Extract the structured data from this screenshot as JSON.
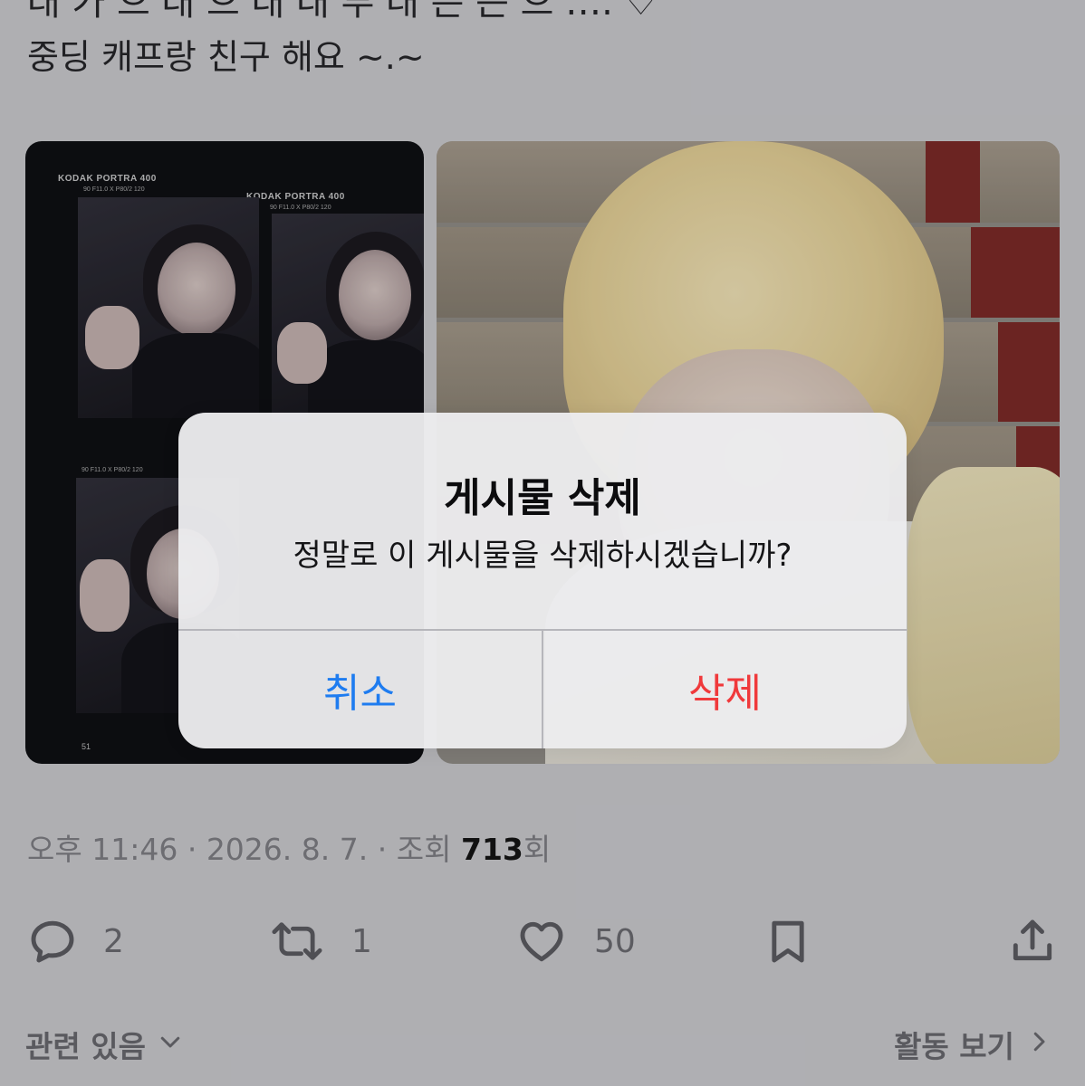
{
  "tweet": {
    "text_cut_line": "대 가 으 대 으 대 대 부 대 은 는 으 …. ♡",
    "text_line": "중딩 캐프랑 친구 해요 ~.~"
  },
  "film": {
    "label_1": "KODAK PORTRA 400",
    "label_2": "KODAK PORTRA 400",
    "sub_1": "90 F11.0     X     P80/2 120",
    "sub_2": "90 F11.0     X     P80/2 120",
    "sub_3": "90 F11.0     X     P80/2 120",
    "frame_number": "51"
  },
  "dialog": {
    "title": "게시물 삭제",
    "message": "정말로 이 게시물을 삭제하시겠습니까?",
    "cancel_label": "취소",
    "delete_label": "삭제",
    "cancel_color": "#1e7cf0",
    "delete_color": "#f0393b"
  },
  "meta": {
    "time": "오후 11:46",
    "date": "2026. 8. 7.",
    "views_label": "조회",
    "views_count": "713",
    "views_suffix": "회",
    "separator": "·"
  },
  "actions": {
    "reply_icon": "reply-icon",
    "reply_count": "2",
    "retweet_icon": "retweet-icon",
    "retweet_count": "1",
    "like_icon": "heart-icon",
    "like_count": "50",
    "bookmark_icon": "bookmark-icon",
    "share_icon": "share-icon"
  },
  "footer": {
    "related_label": "관련 있음",
    "activity_label": "활동 보기"
  }
}
